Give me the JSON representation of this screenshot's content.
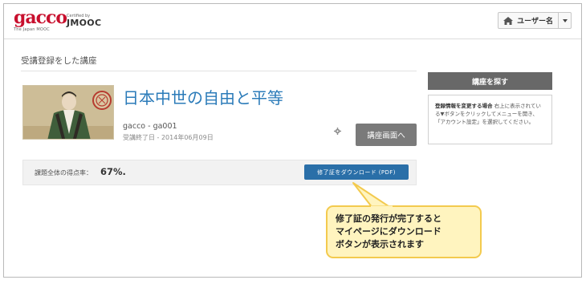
{
  "header": {
    "logo_text": "gacco",
    "logo_tagline": "The Japan MOOC",
    "certified_by": "Certified by",
    "certifier": "JMOOC",
    "user_name": "ユーザー名"
  },
  "main": {
    "page_title": "受講登録をした講座",
    "course": {
      "title": "日本中世の自由と平等",
      "code": "gacco - ga001",
      "end_date": "受講終了日 - 2014年06月09日",
      "open_button": "講座画面へ"
    },
    "score": {
      "label": "課題全体の得点率：",
      "value": "67%",
      "value_suffix": ".",
      "download_button": "修了証をダウンロード (PDF)"
    }
  },
  "sidebar": {
    "find_course_button": "講座を探す",
    "info_heading": "登録情報を変更する場合",
    "info_body": "右上に表示されている▼ボタンをクリックしてメニューを開き、「アカウント設定」を選択してください。"
  },
  "callout": {
    "lines": [
      "修了証の発行が完了すると",
      "マイページにダウンロード",
      "ボタンが表示されます"
    ]
  },
  "colors": {
    "brand_red": "#c8102e",
    "link_blue": "#2b7bb9",
    "download_blue": "#2a6fa8",
    "button_gray": "#7a7a7a",
    "callout_fill": "#fff4bf",
    "callout_border": "#f3ca4e"
  }
}
